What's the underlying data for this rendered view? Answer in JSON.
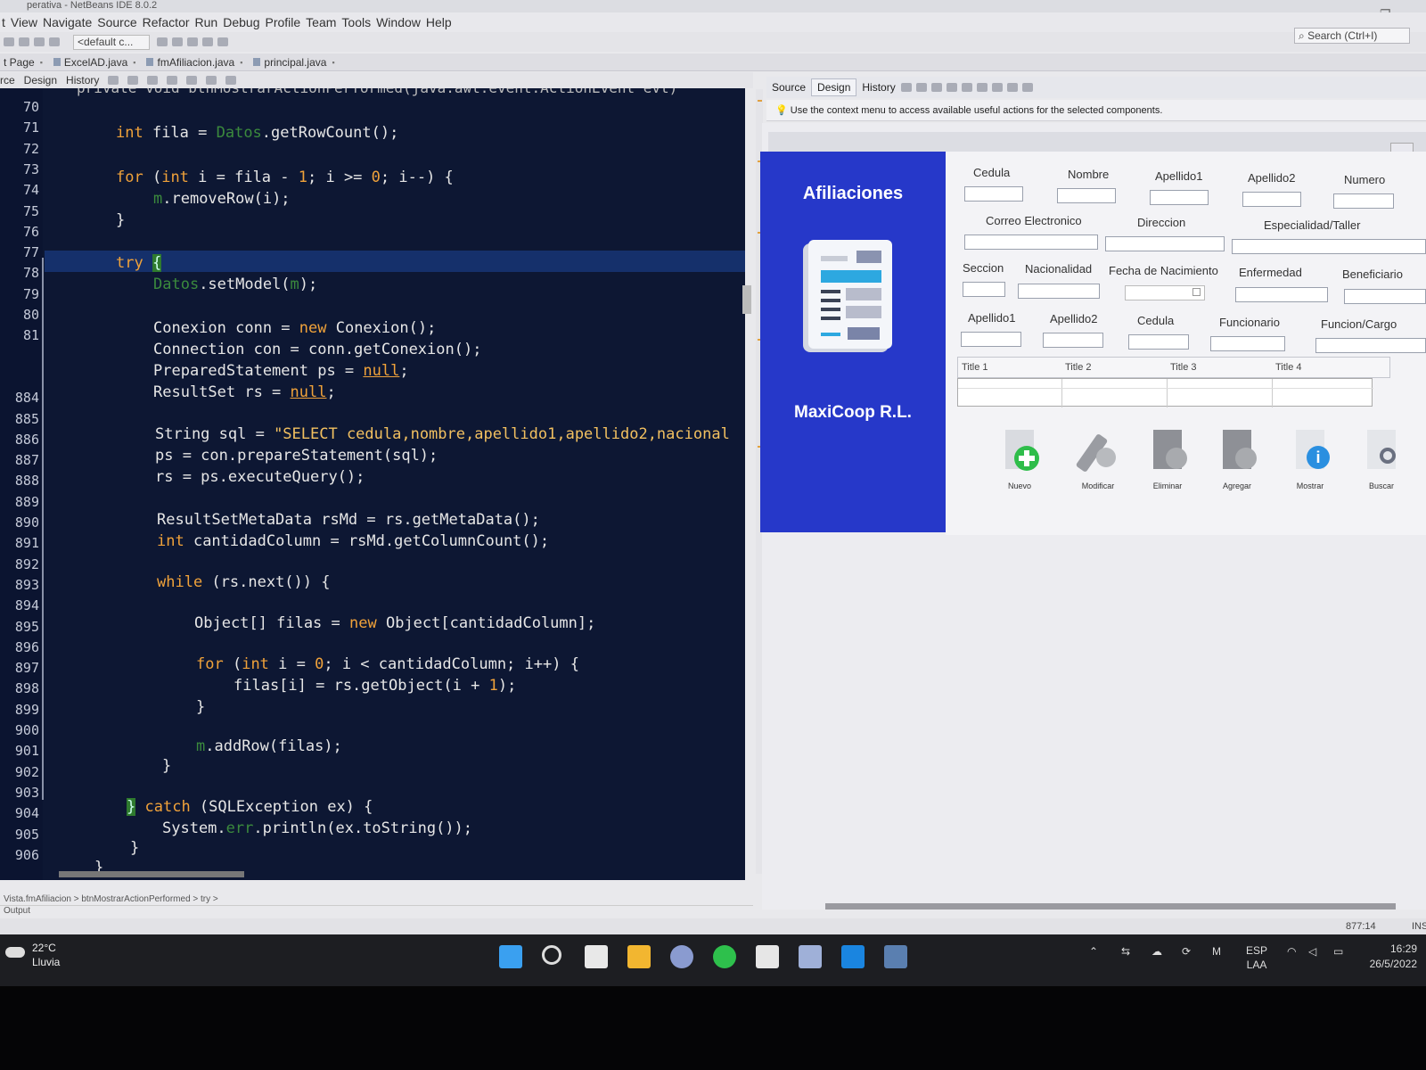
{
  "window": {
    "title": "perativa - NetBeans IDE 8.0.2"
  },
  "menu": [
    "t",
    "View",
    "Navigate",
    "Source",
    "Refactor",
    "Run",
    "Debug",
    "Profile",
    "Team",
    "Tools",
    "Window",
    "Help"
  ],
  "toolbar": {
    "config_combo": "<default c...",
    "search_placeholder": "Search (Ctrl+I)"
  },
  "tabs": [
    "t Page",
    "ExcelAD.java",
    "fmAfiliacion.java",
    "principal.java"
  ],
  "left_subbar": [
    "rce",
    "Design",
    "History"
  ],
  "editor": {
    "line_numbers": [
      "70",
      "71",
      "72",
      "73",
      "74",
      "75",
      "76",
      "77",
      "78",
      "79",
      "80",
      "81",
      "",
      "",
      "884",
      "885",
      "886",
      "887",
      "888",
      "889",
      "890",
      "891",
      "892",
      "893",
      "894",
      "895",
      "896",
      "897",
      "898",
      "899",
      "900",
      "901",
      "902",
      "903",
      "904",
      "905",
      "906"
    ],
    "top_partial": "private void btnMostrarActionPerformed(java.awt.event.ActionEvent evt)"
  },
  "right_subbar": {
    "tabs": [
      "Source",
      "Design",
      "History"
    ],
    "active": "Design"
  },
  "hint": "Use the context menu to access available useful actions for the selected components.",
  "form": {
    "side_title": "Afiliaciones",
    "brand": "MaxiCoop R.L.",
    "labels": {
      "cedula": "Cedula",
      "nombre": "Nombre",
      "apellido1": "Apellido1",
      "apellido2": "Apellido2",
      "numero": "Numero",
      "correo": "Correo Electronico",
      "direccion": "Direccion",
      "especialidad": "Especialidad/Taller",
      "seccion": "Seccion",
      "nacionalidad": "Nacionalidad",
      "fecha": "Fecha de Nacimiento",
      "enfermedad": "Enfermedad",
      "beneficiario": "Beneficiario",
      "b_apellido1": "Apellido1",
      "b_apellido2": "Apellido2",
      "b_cedula": "Cedula",
      "funcionario": "Funcionario",
      "funcion": "Funcion/Cargo"
    },
    "table_headers": [
      "Title 1",
      "Title 2",
      "Title 3",
      "Title 4"
    ],
    "actions": [
      "Nuevo",
      "Modificar",
      "Eliminar",
      "Agregar",
      "Mostrar",
      "Buscar"
    ]
  },
  "breadcrumb": "Vista.fmAfiliacion > btnMostrarActionPerformed > try >",
  "output": "Output",
  "status": {
    "position": "877:14",
    "mode": "INS"
  },
  "taskbar": {
    "weather_temp": "22°C",
    "weather_desc": "Lluvia",
    "lang1": "ESP",
    "lang2": "LAA",
    "time": "16:29",
    "date": "26/5/2022"
  }
}
